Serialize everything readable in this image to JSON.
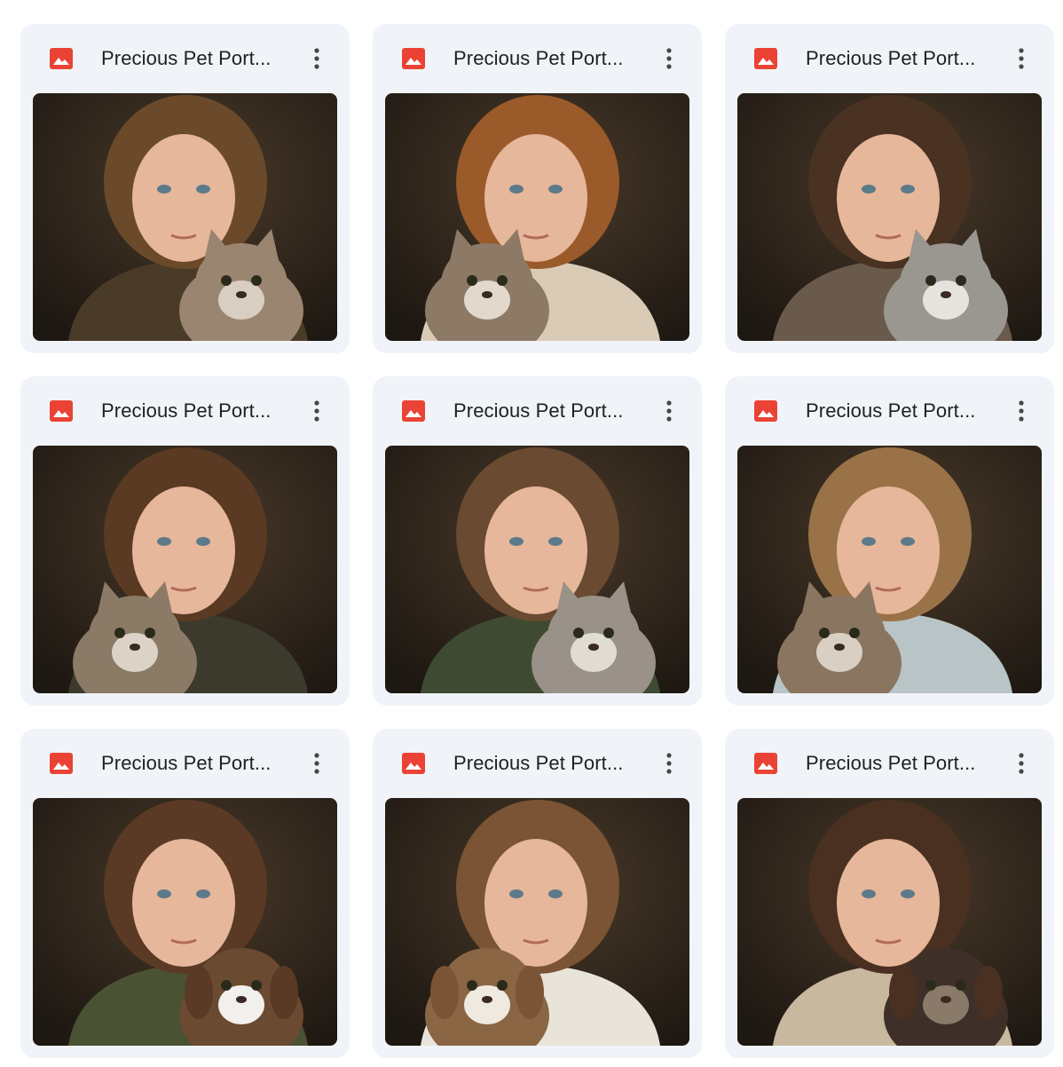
{
  "files": [
    {
      "title": "Precious Pet Port...",
      "type_icon": "image-file-icon",
      "subject": "child-with-kitten",
      "hair": "#6b4a2b",
      "pet": "#9a8670",
      "shirt": "#4a3a28",
      "pet_fur_light": "#d8cfc2"
    },
    {
      "title": "Precious Pet Port...",
      "type_icon": "image-file-icon",
      "subject": "child-with-kitten",
      "hair": "#9a5a2a",
      "pet": "#8d7a66",
      "shirt": "#d9cbb6",
      "pet_fur_light": "#e2d9cc"
    },
    {
      "title": "Precious Pet Port...",
      "type_icon": "image-file-icon",
      "subject": "child-with-kitten",
      "hair": "#4a3222",
      "pet": "#9a9690",
      "shirt": "#6a5a4c",
      "pet_fur_light": "#e6e3de"
    },
    {
      "title": "Precious Pet Port...",
      "type_icon": "image-file-icon",
      "subject": "child-with-kitten",
      "hair": "#5a3a22",
      "pet": "#8a7a66",
      "shirt": "#3b3a2c",
      "pet_fur_light": "#dcd3c6"
    },
    {
      "title": "Precious Pet Port...",
      "type_icon": "image-file-icon",
      "subject": "child-with-kitten",
      "hair": "#6a4a30",
      "pet": "#9a9288",
      "shirt": "#3f4a32",
      "pet_fur_light": "#e0dbd3"
    },
    {
      "title": "Precious Pet Port...",
      "type_icon": "image-file-icon",
      "subject": "child-with-kitten",
      "hair": "#9a7248",
      "pet": "#8a7660",
      "shirt": "#b9c4c6",
      "pet_fur_light": "#d9d0c3"
    },
    {
      "title": "Precious Pet Port...",
      "type_icon": "image-file-icon",
      "subject": "child-with-puppy",
      "hair": "#5a3a24",
      "pet": "#6a4a30",
      "shirt": "#4a5234",
      "pet_fur_light": "#f2f0ec"
    },
    {
      "title": "Precious Pet Port...",
      "type_icon": "image-file-icon",
      "subject": "child-with-puppy",
      "hair": "#7a5434",
      "pet": "#8a6644",
      "shirt": "#e9e4da",
      "pet_fur_light": "#efe9e0"
    },
    {
      "title": "Precious Pet Port...",
      "type_icon": "image-file-icon",
      "subject": "child-with-puppy",
      "hair": "#4a3020",
      "pet": "#3e3028",
      "shirt": "#c8b89e",
      "pet_fur_light": "#8a7a6a"
    }
  ],
  "menu_icon": "more-vert-icon",
  "colors": {
    "card_bg": "#f0f4f9",
    "icon_red": "#ea4335",
    "title": "#1f1f1f",
    "thumb_bg": "#1e1812",
    "skin": "#e6b79a"
  }
}
